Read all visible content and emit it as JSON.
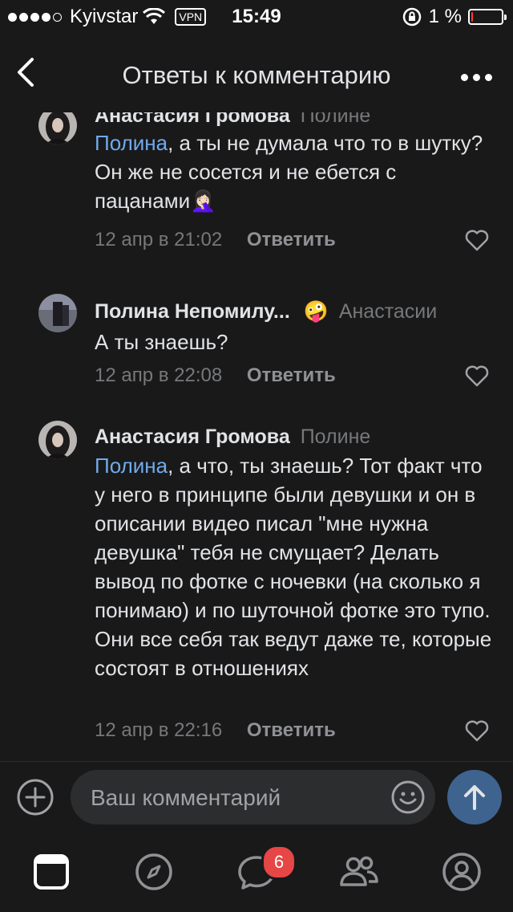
{
  "status_bar": {
    "carrier": "Kyivstar",
    "vpn": "VPN",
    "time": "15:49",
    "battery_percent": "1 %",
    "battery_level": 0.01,
    "signal_bars": 4
  },
  "nav": {
    "title": "Ответы к комментарию",
    "back_icon": "chevron-left-icon",
    "more_icon": "more-horizontal-icon"
  },
  "comments": [
    {
      "author": "Анастасия Громова",
      "reply_to": "Полине",
      "mention": "Полина",
      "text": ", а ты не думала что то в шутку? Он же не сосется и не ебется с пацанами🤦🏻‍♀️",
      "date": "12 апр в 21:02",
      "reply_label": "Ответить"
    },
    {
      "author": "Полина Непомилу...",
      "author_emoji": "🤪",
      "reply_to": "Анастасии",
      "text": "А ты знаешь?",
      "date": "12 апр в 22:08",
      "reply_label": "Ответить"
    },
    {
      "author": "Анастасия Громова",
      "reply_to": "Полине",
      "mention": "Полина",
      "text": ", а что, ты знаешь? Тот факт что у него в принципе были девушки и он в описании видео писал \"мне нужна девушка\" тебя не смущает? Делать вывод по фотке с ночевки (на сколько я понимаю) и по шуточной фотке это тупо. Они все себя так ведут даже те, которые состоят в отношениях",
      "date": "12 апр в 22:16",
      "reply_label": "Ответить"
    }
  ],
  "composer": {
    "placeholder": "Ваш комментарий"
  },
  "tabbar": {
    "messages_badge": "6"
  },
  "colors": {
    "background": "#19191a",
    "accent": "#71aaeb",
    "send_button": "#3f638f",
    "badge": "#e64646"
  }
}
